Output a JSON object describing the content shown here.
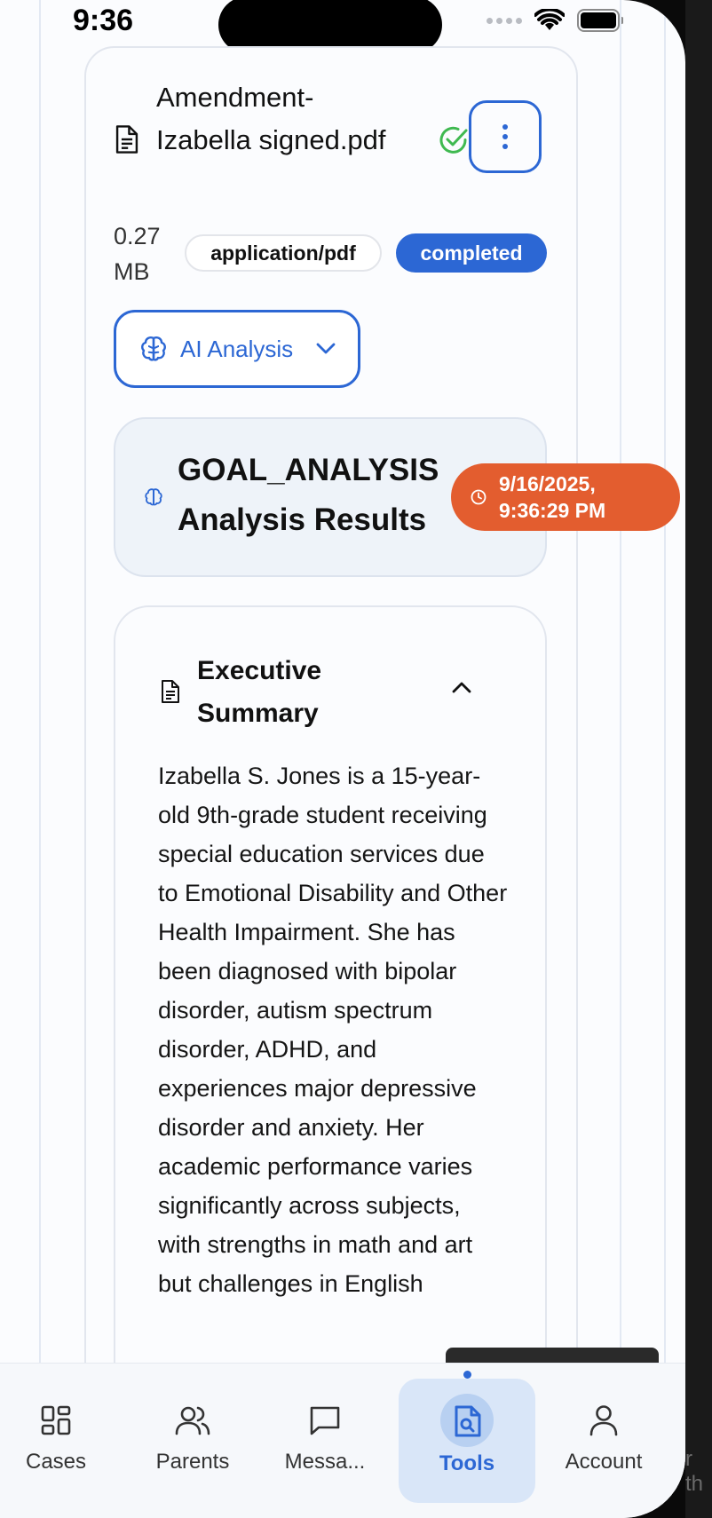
{
  "status_bar": {
    "time": "9:36"
  },
  "file": {
    "name": "Amendment-Izabella signed.pdf",
    "size": "0.27 MB",
    "mime_type": "application/pdf",
    "status": "completed"
  },
  "ai_analysis_button": {
    "label": "AI Analysis"
  },
  "analysis": {
    "title": "GOAL_ANALYSIS Analysis Results",
    "timestamp": "9/16/2025, 9:36:29 PM"
  },
  "summary": {
    "title": "Executive Summary",
    "text": "Izabella S. Jones is a 15-year-old 9th-grade student receiving special education services due to Emotional Disability and Other Health Impairment. She has been diagnosed with bipolar disorder, autism spectrum disorder, ADHD, and experiences major depressive disorder and anxiety. Her academic performance varies significantly across subjects, with strengths in math and art but challenges in English"
  },
  "tabs": [
    {
      "label": "Cases",
      "icon": "grid-icon"
    },
    {
      "label": "Parents",
      "icon": "users-icon"
    },
    {
      "label": "Messa...",
      "icon": "message-icon"
    },
    {
      "label": "Tools",
      "icon": "file-search-icon",
      "active": true
    },
    {
      "label": "Account",
      "icon": "user-icon"
    }
  ],
  "colors": {
    "accent": "#2c67d4",
    "timestamp_badge": "#e35d2f",
    "success": "#3fb950"
  },
  "bezel_text": "r th"
}
